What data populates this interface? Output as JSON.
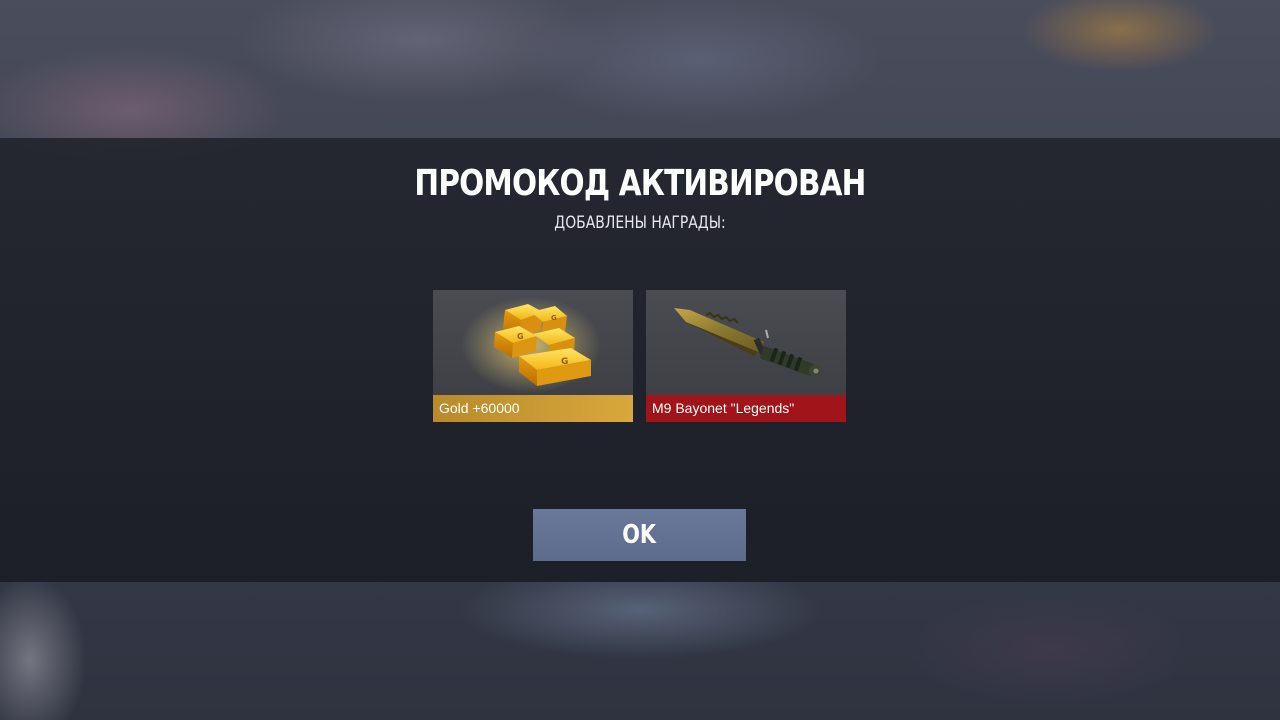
{
  "dialog": {
    "title": "ПРОМОКОД АКТИВИРОВАН",
    "subtitle": "ДОБАВЛЕНЫ НАГРАДЫ:",
    "ok_label": "OK"
  },
  "rewards": [
    {
      "label": "Gold +60000",
      "icon": "gold-bars-icon",
      "rarity_color": "#d1a03a"
    },
    {
      "label": "M9 Bayonet \"Legends\"",
      "icon": "knife-icon",
      "rarity_color": "#a0141a"
    }
  ],
  "colors": {
    "accent_button": "#627092",
    "modal_background": "#22252e"
  }
}
